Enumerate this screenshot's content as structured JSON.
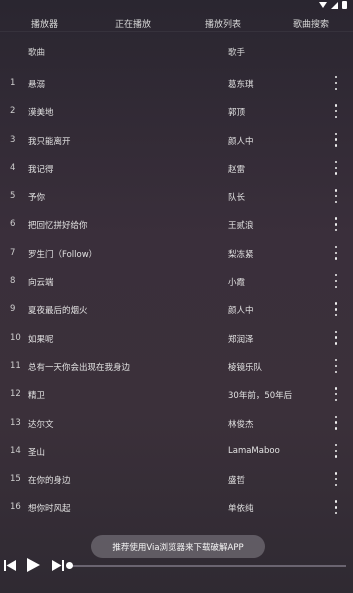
{
  "tabs": [
    {
      "label": "播放器"
    },
    {
      "label": "正在播放"
    },
    {
      "label": "播放列表"
    },
    {
      "label": "歌曲搜索"
    }
  ],
  "header": {
    "song_col": "歌曲",
    "artist_col": "歌手"
  },
  "songs": [
    {
      "index": "1",
      "title": "悬溺",
      "artist": "葛东琪"
    },
    {
      "index": "2",
      "title": "漠美地",
      "artist": "郭顶"
    },
    {
      "index": "3",
      "title": "我只能离开",
      "artist": "颜人中"
    },
    {
      "index": "4",
      "title": "我记得",
      "artist": "赵雷"
    },
    {
      "index": "5",
      "title": "予你",
      "artist": "队长"
    },
    {
      "index": "6",
      "title": "把回忆拼好给你",
      "artist": "王贰浪"
    },
    {
      "index": "7",
      "title": "罗生门（Follow）",
      "artist": "梨冻紧"
    },
    {
      "index": "8",
      "title": "向云端",
      "artist": "小霞"
    },
    {
      "index": "9",
      "title": "夏夜最后的烟火",
      "artist": "颜人中"
    },
    {
      "index": "10",
      "title": "如果呢",
      "artist": "郑润泽"
    },
    {
      "index": "11",
      "title": "总有一天你会出现在我身边",
      "artist": "棱镜乐队"
    },
    {
      "index": "12",
      "title": "精卫",
      "artist": "30年前，50年后"
    },
    {
      "index": "13",
      "title": "达尔文",
      "artist": "林俊杰"
    },
    {
      "index": "14",
      "title": "圣山",
      "artist": "LamaMaboo"
    },
    {
      "index": "15",
      "title": "在你的身边",
      "artist": "盛哲"
    },
    {
      "index": "16",
      "title": "想你时风起",
      "artist": "单依纯"
    }
  ],
  "toast": "推荐使用Via浏览器来下载破解APP",
  "player": {
    "progress": 0.0
  },
  "icons": {
    "more": "more-vertical-icon",
    "prev": "skip-previous-icon",
    "play": "play-icon",
    "next": "skip-next-icon"
  }
}
